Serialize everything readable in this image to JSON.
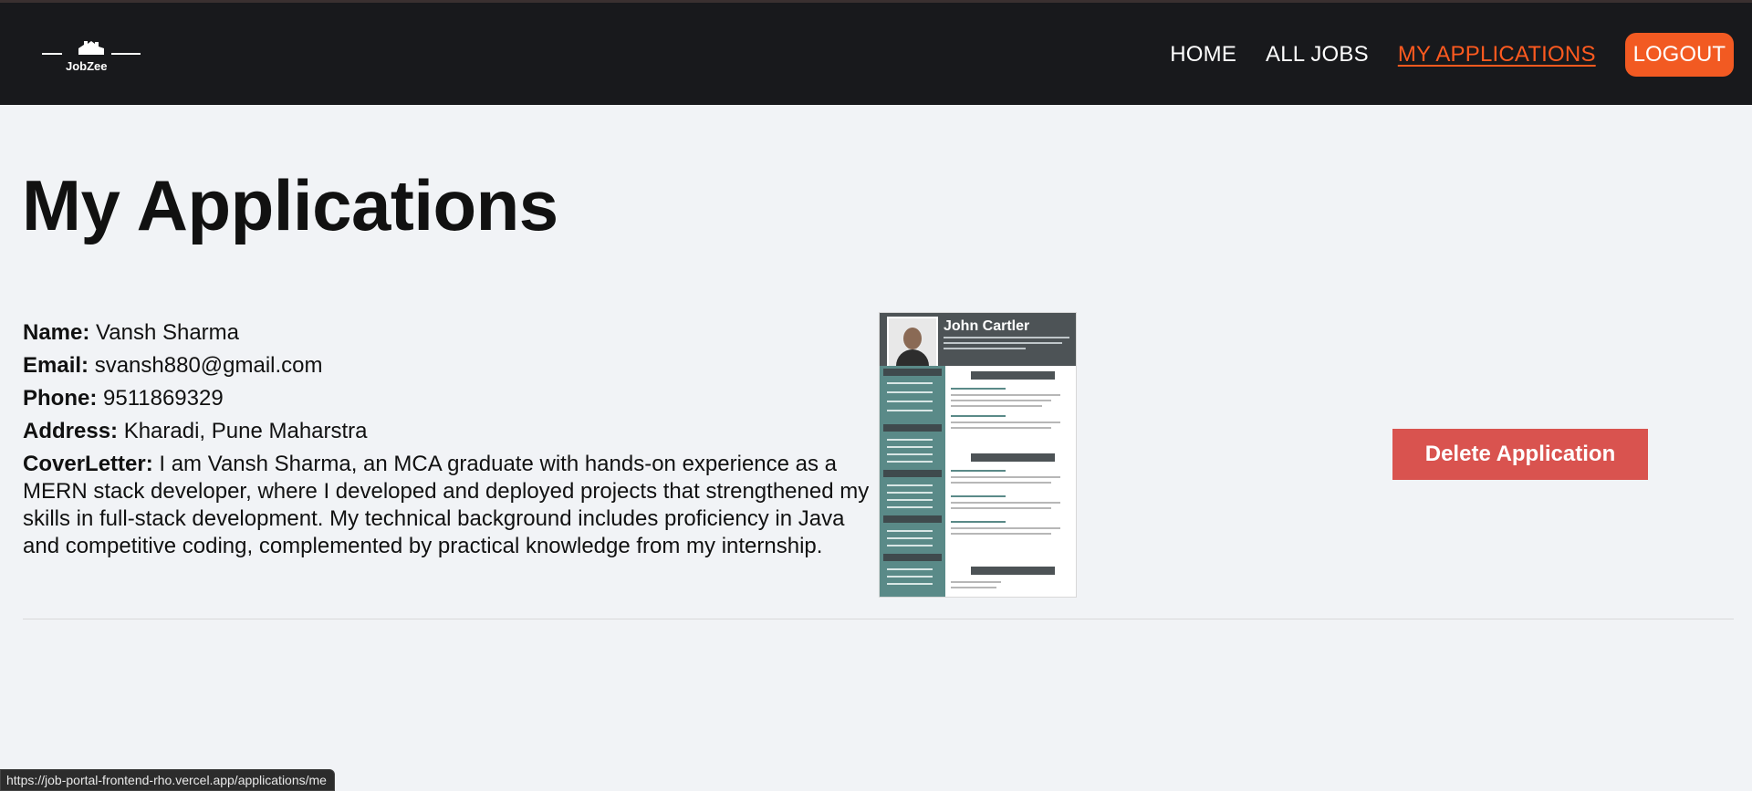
{
  "brand": {
    "logo_text": "JobZee"
  },
  "nav": {
    "home": "HOME",
    "all_jobs": "ALL JOBS",
    "my_applications": "MY APPLICATIONS",
    "logout": "LOGOUT"
  },
  "colors": {
    "navbar_bg": "#18191c",
    "accent": "#f25a22",
    "page_bg": "#f1f3f6",
    "delete_button": "#d9534f"
  },
  "page": {
    "title": "My Applications"
  },
  "application": {
    "name_label": "Name:",
    "name": "Vansh Sharma",
    "email_label": "Email:",
    "email": "svansh880@gmail.com",
    "phone_label": "Phone:",
    "phone": "9511869329",
    "address_label": "Address:",
    "address": "Kharadi, Pune Maharstra",
    "cover_label": "CoverLetter:",
    "cover_letter": "I am Vansh Sharma, an MCA graduate with hands-on experience as a MERN stack developer, where I developed and deployed projects that strengthened my skills in full-stack development. My technical background includes proficiency in Java and competitive coding, complemented by practical knowledge from my internship.",
    "resume": {
      "name": "John Cartler"
    },
    "delete_label": "Delete Application"
  },
  "status_bar": {
    "url": "https://job-portal-frontend-rho.vercel.app/applications/me"
  }
}
